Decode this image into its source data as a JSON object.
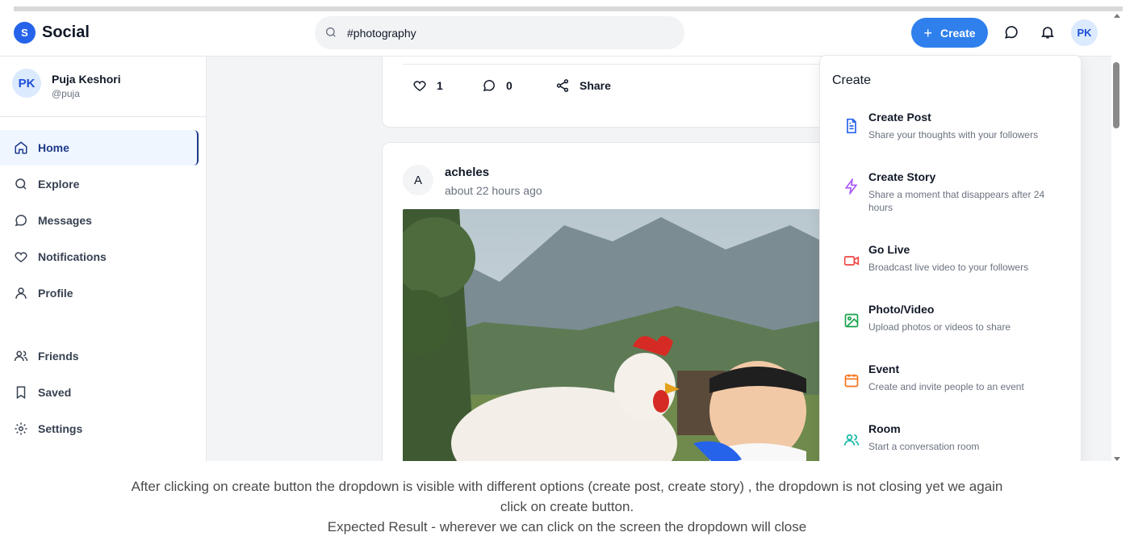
{
  "app": {
    "logo_letter": "S",
    "name": "Social"
  },
  "search": {
    "value": "#photography"
  },
  "header": {
    "create_label": "Create",
    "create_plus": "+",
    "avatar_initials": "PK"
  },
  "user": {
    "initials": "PK",
    "name": "Puja Keshori",
    "handle": "@puja"
  },
  "sidebar": {
    "items": [
      {
        "label": "Home",
        "icon": "home-icon",
        "active": true
      },
      {
        "label": "Explore",
        "icon": "search-icon"
      },
      {
        "label": "Messages",
        "icon": "message-icon"
      },
      {
        "label": "Notifications",
        "icon": "heart-icon"
      },
      {
        "label": "Profile",
        "icon": "user-icon"
      },
      {
        "label": "Friends",
        "icon": "users-icon"
      },
      {
        "label": "Saved",
        "icon": "bookmark-icon"
      },
      {
        "label": "Settings",
        "icon": "gear-icon"
      }
    ]
  },
  "feed": {
    "prev_post": {
      "likes": "1",
      "comments": "0",
      "share_label": "Share"
    },
    "post": {
      "avatar_letter": "A",
      "author": "acheles",
      "time": "about 22 hours ago"
    }
  },
  "dropdown": {
    "title": "Create",
    "items": [
      {
        "title": "Create Post",
        "desc": "Share your thoughts with your followers",
        "icon": "document-icon",
        "color": "#2563eb"
      },
      {
        "title": "Create Story",
        "desc": "Share a moment that disappears after 24 hours",
        "icon": "lightning-icon",
        "color": "#a855f7"
      },
      {
        "title": "Go Live",
        "desc": "Broadcast live video to your followers",
        "icon": "video-icon",
        "color": "#ef4444"
      },
      {
        "title": "Photo/Video",
        "desc": "Upload photos or videos to share",
        "icon": "image-icon",
        "color": "#16a34a"
      },
      {
        "title": "Event",
        "desc": "Create and invite people to an event",
        "icon": "calendar-icon",
        "color": "#f97316"
      },
      {
        "title": "Room",
        "desc": "Start a conversation room",
        "icon": "users-icon",
        "color": "#14b8a6"
      }
    ]
  },
  "caption": {
    "line1": "After clicking on create button the dropdown is visible with different options (create post, create story) , the dropdown is not closing yet we again",
    "line2": "click on create button.",
    "line3": "Expected Result - wherever we can click on the screen the dropdown will close"
  }
}
